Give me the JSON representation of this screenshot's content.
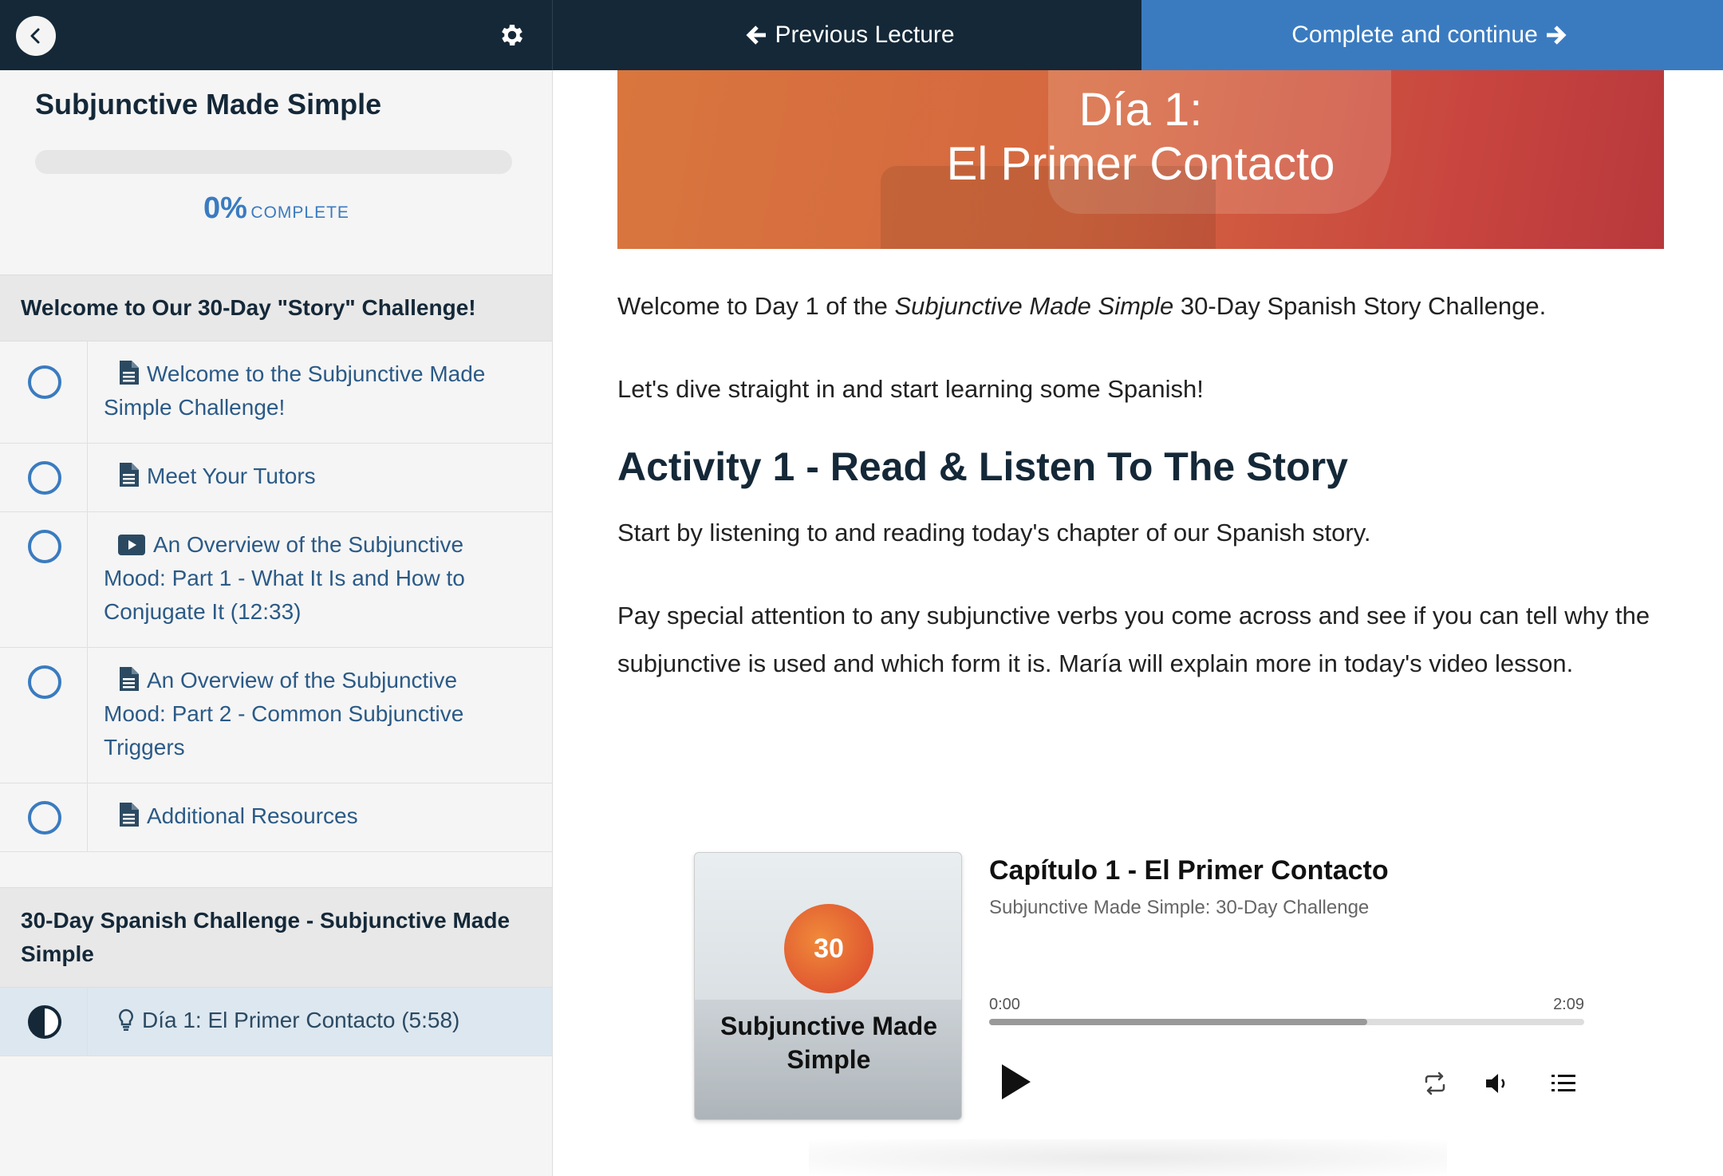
{
  "topbar": {
    "prev_label": "Previous Lecture",
    "next_label": "Complete and continue"
  },
  "sidebar": {
    "course_title": "Subjunctive Made Simple",
    "progress_percent": "0%",
    "progress_label": "COMPLETE",
    "progress_value": 0,
    "sections": [
      {
        "title": "Welcome to Our 30-Day \"Story\" Challenge!",
        "lectures": [
          {
            "icon": "document-icon",
            "title": "Welcome to the Subjunctive Made Simple Challenge!",
            "status": "incomplete"
          },
          {
            "icon": "document-icon",
            "title": "Meet Your Tutors",
            "status": "incomplete"
          },
          {
            "icon": "video-icon",
            "title": "An Overview of the Subjunctive Mood: Part 1 - What It Is and How to Conjugate It (12:33)",
            "status": "incomplete"
          },
          {
            "icon": "document-icon",
            "title": "An Overview of the Subjunctive Mood: Part 2 - Common Subjunctive Triggers",
            "status": "incomplete"
          },
          {
            "icon": "document-icon",
            "title": "Additional Resources",
            "status": "incomplete"
          }
        ]
      },
      {
        "title": "30-Day Spanish Challenge - Subjunctive Made Simple",
        "lectures": [
          {
            "icon": "lightbulb-icon",
            "title": "Día 1: El Primer Contacto (5:58)",
            "status": "in-progress"
          }
        ]
      }
    ]
  },
  "main": {
    "hero_line1": "Día 1:",
    "hero_line2": "El Primer Contacto",
    "intro_before": "Welcome to Day 1 of the ",
    "intro_em": "Subjunctive Made Simple",
    "intro_after": " 30-Day Spanish Story Challenge.",
    "para2": "Let's dive straight in and start learning some Spanish!",
    "activity_heading": "Activity 1 - Read & Listen To The Story",
    "para3": "Start by listening to and reading today's chapter of our Spanish story.",
    "para4": "Pay special attention to any subjunctive verbs you come across and see if you can tell why the subjunctive is used and which form it is. María will explain more in today's video lesson."
  },
  "player": {
    "cover_badge": "30",
    "cover_title": "Subjunctive Made Simple",
    "episode_title": "Capítulo 1 - El Primer Contacto",
    "show_title": "Subjunctive Made Simple: 30-Day Challenge",
    "time_current": "0:00",
    "time_total": "2:09",
    "buffered_fraction": 0.635
  },
  "colors": {
    "navy": "#142838",
    "accent_blue": "#3a7bc0"
  }
}
